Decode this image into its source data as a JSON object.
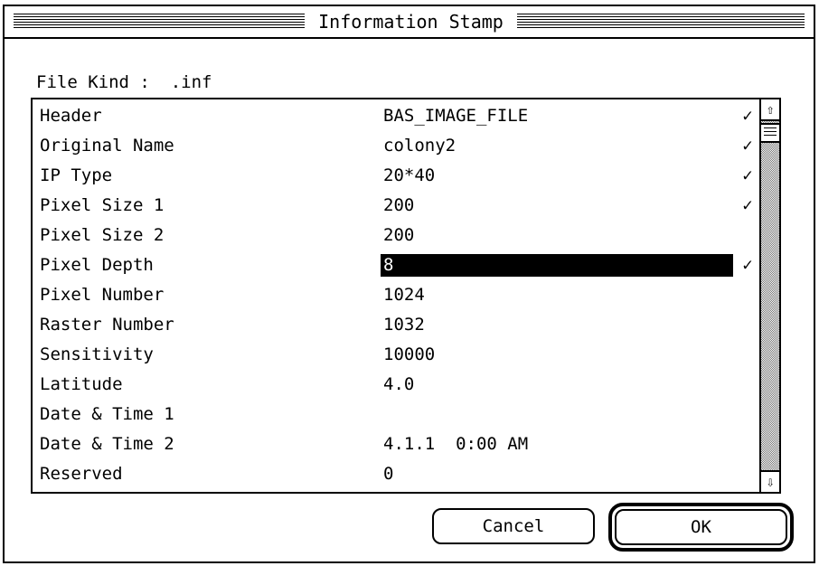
{
  "window": {
    "title": "Information Stamp"
  },
  "file_kind": "File Kind :  .inf",
  "rows": [
    {
      "label": "Header",
      "value": "BAS_IMAGE_FILE",
      "checked": "✓"
    },
    {
      "label": "Original Name",
      "value": "colony2",
      "checked": "✓"
    },
    {
      "label": "IP Type",
      "value": "20*40",
      "checked": "✓"
    },
    {
      "label": "Pixel Size 1",
      "value": "200",
      "checked": "✓"
    },
    {
      "label": "Pixel Size 2",
      "value": "200",
      "checked": ""
    },
    {
      "label": "Pixel Depth",
      "value": "8",
      "checked": "✓",
      "selected": true
    },
    {
      "label": "Pixel Number",
      "value": "1024",
      "checked": ""
    },
    {
      "label": "Raster Number",
      "value": "1032",
      "checked": ""
    },
    {
      "label": "Sensitivity",
      "value": "10000",
      "checked": ""
    },
    {
      "label": "Latitude",
      "value": "4.0",
      "checked": ""
    },
    {
      "label": "Date & Time 1",
      "value": "",
      "checked": ""
    },
    {
      "label": "Date & Time 2",
      "value": "4.1.1  0:00 AM",
      "checked": ""
    },
    {
      "label": "Reserved",
      "value": "0",
      "checked": ""
    }
  ],
  "scrollbar": {
    "up_icon": "arrow-up-icon",
    "down_icon": "arrow-down-icon"
  },
  "buttons": {
    "cancel": "Cancel",
    "ok": "OK"
  }
}
